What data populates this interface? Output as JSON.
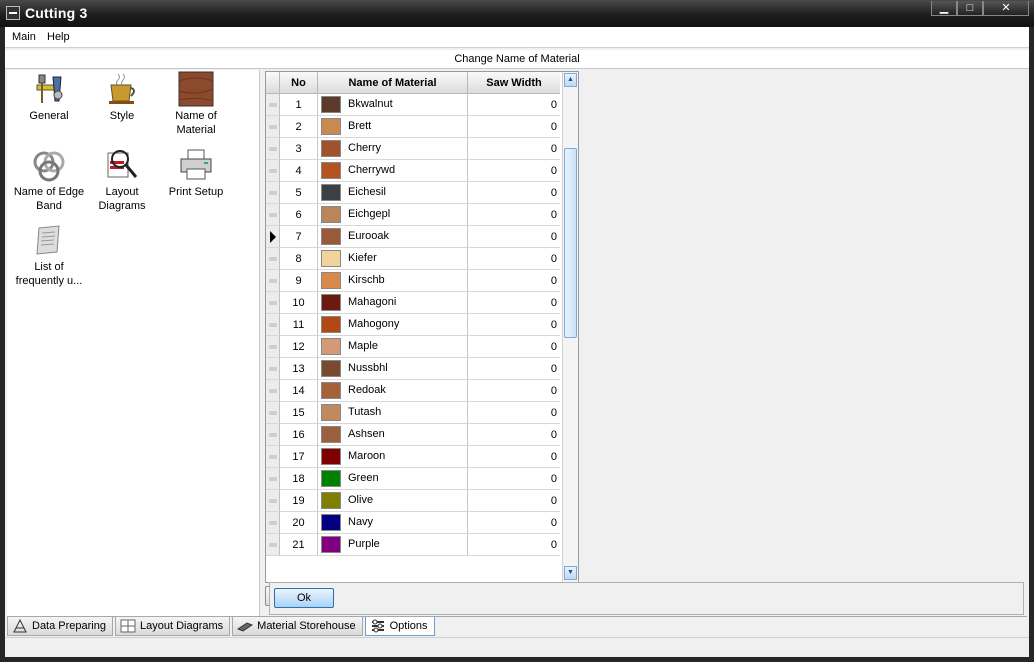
{
  "window": {
    "title": "Cutting 3",
    "minimize": "▁",
    "maximize": "□",
    "close": "✕"
  },
  "menu": {
    "main": "Main",
    "help": "Help"
  },
  "header": {
    "title": "Change Name of Material"
  },
  "options": [
    {
      "label": "General",
      "icon": "tools-icon"
    },
    {
      "label": "Style",
      "icon": "coffee-cup-icon"
    },
    {
      "label": "Name of Material",
      "icon": "wood-texture-icon"
    },
    {
      "label": "Name of Edge Band",
      "icon": "knot-icon"
    },
    {
      "label": "Layout Diagrams",
      "icon": "magnifier-icon"
    },
    {
      "label": "Print Setup",
      "icon": "printer-icon"
    },
    {
      "label": "List of frequently u...",
      "icon": "scroll-icon"
    }
  ],
  "grid": {
    "columns": {
      "no": "No",
      "name": "Name of Material",
      "saw": "Saw Width"
    },
    "current_row": 7,
    "rows": [
      {
        "no": "1",
        "name": "Bkwalnut",
        "saw": "0",
        "color": "#5a3a2a"
      },
      {
        "no": "2",
        "name": "Brett",
        "saw": "0",
        "color": "#c98a52"
      },
      {
        "no": "3",
        "name": "Cherry",
        "saw": "0",
        "color": "#a0522d"
      },
      {
        "no": "4",
        "name": "Cherrywd",
        "saw": "0",
        "color": "#b5541f"
      },
      {
        "no": "5",
        "name": "Eichesil",
        "saw": "0",
        "color": "#3c3f44"
      },
      {
        "no": "6",
        "name": "Eichgepl",
        "saw": "0",
        "color": "#b8865a"
      },
      {
        "no": "7",
        "name": "Eurooak",
        "saw": "0",
        "color": "#9a5a3a"
      },
      {
        "no": "8",
        "name": "Kiefer",
        "saw": "0",
        "color": "#f2d39a"
      },
      {
        "no": "9",
        "name": "Kirschb",
        "saw": "0",
        "color": "#d98a4a"
      },
      {
        "no": "10",
        "name": "Mahagoni",
        "saw": "0",
        "color": "#6a1a0e"
      },
      {
        "no": "11",
        "name": "Mahogony",
        "saw": "0",
        "color": "#b04a12"
      },
      {
        "no": "12",
        "name": "Maple",
        "saw": "0",
        "color": "#d49a78"
      },
      {
        "no": "13",
        "name": "Nussbhl",
        "saw": "0",
        "color": "#7a4a2e"
      },
      {
        "no": "14",
        "name": "Redoak",
        "saw": "0",
        "color": "#a8603a"
      },
      {
        "no": "15",
        "name": "Tutash",
        "saw": "0",
        "color": "#c08a5e"
      },
      {
        "no": "16",
        "name": "Ashsen",
        "saw": "0",
        "color": "#9a6040"
      },
      {
        "no": "17",
        "name": "Maroon",
        "saw": "0",
        "color": "#800000"
      },
      {
        "no": "18",
        "name": "Green",
        "saw": "0",
        "color": "#008000"
      },
      {
        "no": "19",
        "name": "Olive",
        "saw": "0",
        "color": "#808000"
      },
      {
        "no": "20",
        "name": "Navy",
        "saw": "0",
        "color": "#000080"
      },
      {
        "no": "21",
        "name": "Purple",
        "saw": "0",
        "color": "#800080"
      }
    ]
  },
  "navigator": [
    {
      "glyph": "|◀",
      "name": "nav-first-button",
      "enabled": true
    },
    {
      "glyph": "◀",
      "name": "nav-prior-button",
      "enabled": true
    },
    {
      "glyph": "▶",
      "name": "nav-next-button",
      "enabled": true
    },
    {
      "glyph": "▶|",
      "name": "nav-last-button",
      "enabled": true
    },
    {
      "glyph": "▲",
      "name": "nav-edit-button",
      "enabled": true
    },
    {
      "glyph": "✔",
      "name": "nav-post-button",
      "enabled": false
    },
    {
      "glyph": "✖",
      "name": "nav-cancel-button",
      "enabled": false
    },
    {
      "glyph": "↻",
      "name": "nav-refresh-button",
      "enabled": true
    }
  ],
  "ok_label": "Ok",
  "tabs": [
    {
      "label": "Data Preparing",
      "icon": "data-preparing-icon",
      "active": false
    },
    {
      "label": "Layout Diagrams",
      "icon": "layout-icon",
      "active": false
    },
    {
      "label": "Material Storehouse",
      "icon": "storehouse-icon",
      "active": false
    },
    {
      "label": "Options",
      "icon": "options-icon",
      "active": true
    }
  ]
}
